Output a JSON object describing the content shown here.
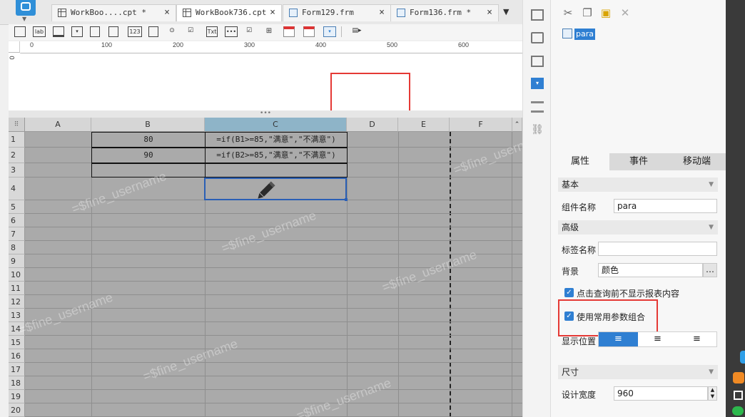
{
  "tabs": [
    {
      "label": "WorkBoo....cpt *",
      "close": "×"
    },
    {
      "label": "WorkBook736.cpt",
      "close": "×"
    },
    {
      "label": "Form129.frm",
      "close": "×"
    },
    {
      "label": "Form136.frm *",
      "close": "×"
    }
  ],
  "widget_toolbar": {
    "items": [
      "lab",
      "123",
      "Txt"
    ]
  },
  "ruler": {
    "marks": [
      "0",
      "100",
      "200",
      "300",
      "400",
      "500",
      "600"
    ],
    "vmark": "0"
  },
  "splitter": {
    "label": "•••"
  },
  "grid": {
    "corner": "⠿",
    "columns": [
      "A",
      "B",
      "C",
      "D",
      "E",
      "F"
    ],
    "selected_column": "C",
    "rows": [
      "1",
      "2",
      "3",
      "4",
      "5",
      "6",
      "7",
      "8",
      "9",
      "10",
      "11",
      "12",
      "13",
      "14",
      "15",
      "16",
      "17",
      "18",
      "19",
      "20"
    ],
    "cells": {
      "B1": "80",
      "B2": "90",
      "C1": "=if(B1>=85,\"满意\",\"不满意\")",
      "C2": "=if(B2>=85,\"满意\",\"不满意\")"
    },
    "watermark": "=$fine_username"
  },
  "component_list": {
    "item": "para"
  },
  "property_tabs": [
    "属性",
    "事件",
    "移动端"
  ],
  "properties": {
    "basic_section": "基本",
    "component_name_label": "组件名称",
    "component_name_value": "para",
    "advanced_section": "高级",
    "tag_name_label": "标签名称",
    "tag_name_value": "",
    "background_label": "背景",
    "background_value": "颜色",
    "background_more": "…",
    "option1": "点击查询前不显示报表内容",
    "option2": "使用常用参数组合",
    "display_position_label": "显示位置",
    "size_section": "尺寸",
    "design_width_label": "设计宽度",
    "design_width_value": "960"
  },
  "colors": {
    "accent": "#2f7fd2",
    "highlight_red": "#e53935",
    "grid_bg": "#aaaaaa"
  }
}
